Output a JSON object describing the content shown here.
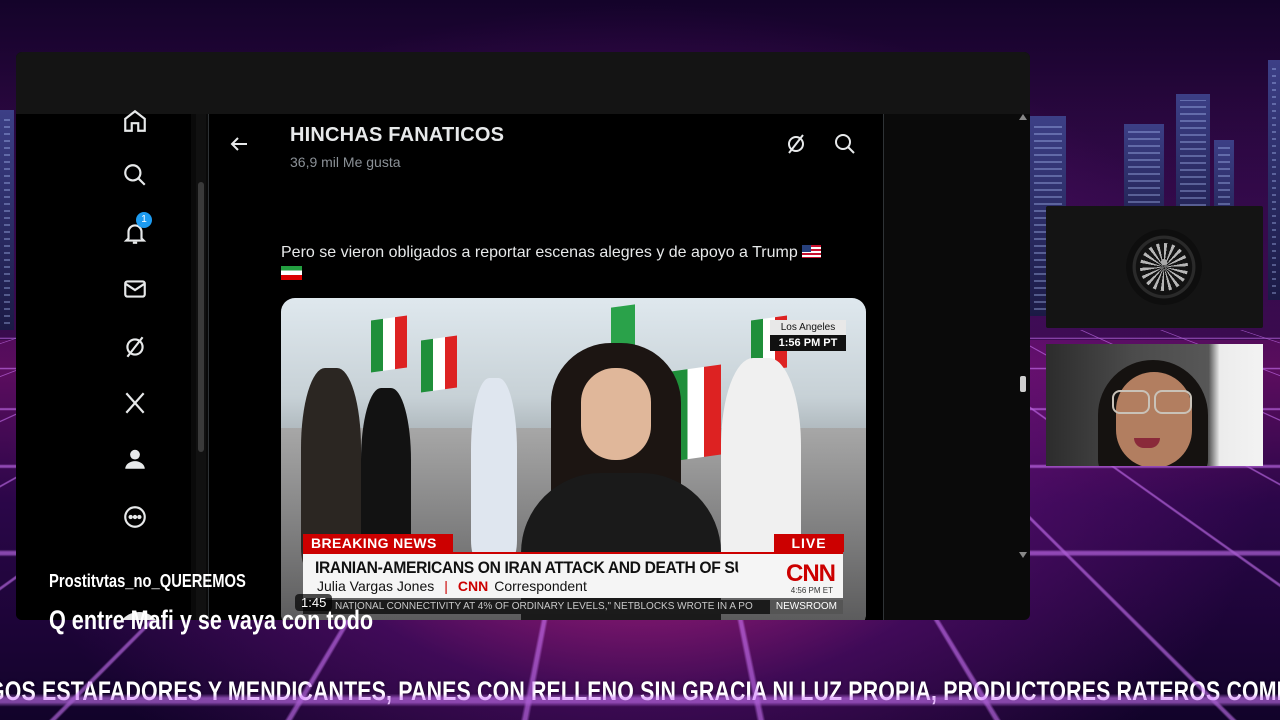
{
  "post": {
    "header_title": "HINCHAS FANATICOS",
    "header_subtitle": "36,9 mil Me gusta",
    "text": "Pero se vieron obligados a reportar escenas alegres y de apoyo a Trump"
  },
  "sidebar": {
    "notifications_count": "1",
    "items": [
      "home-icon",
      "search-icon",
      "notifications-icon",
      "messages-icon",
      "grok-icon",
      "x-logo-icon",
      "profile-icon",
      "more-icon"
    ]
  },
  "video": {
    "location": "Los Angeles",
    "local_time": "1:56 PM PT",
    "breaking_label": "BREAKING NEWS",
    "live_label": "LIVE",
    "headline": "IRANIAN-AMERICANS ON IRAN ATTACK AND DEATH OF SUPREME LEADER",
    "reporter_name": "Julia Vargas Jones",
    "network_mini": "CNN",
    "reporter_role": "Correspondent",
    "network_logo": "CNN",
    "network_time": "4:56 PM ET",
    "ticker_text": "NATIONAL CONNECTIVITY AT 4% OF ORDINARY LEVELS,\" NETBLOCKS WROTE IN A PO",
    "ticker_tag": "NEWSROOM",
    "duration": "1:45"
  },
  "chat": {
    "username": "Prostitvtas_no_QUEREMOS",
    "message": "Q entre Mafi y se vaya con todo"
  },
  "marquee": {
    "text": "GOS ESTAFADORES Y MENDICANTES, PANES CON RELLENO SIN GRACIA NI LUZ PROPIA, PRODUCTORES RATEROS COMPLICES"
  },
  "colors": {
    "accent_blue": "#1d9bf0",
    "cnn_red": "#cc0000",
    "x_background": "#000000",
    "text_primary": "#e7e9ea"
  }
}
